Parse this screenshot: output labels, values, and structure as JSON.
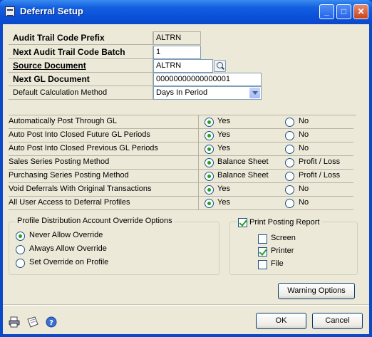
{
  "window": {
    "title": "Deferral Setup",
    "minimize_glyph": "_",
    "maximize_glyph": "□",
    "close_glyph": "✕"
  },
  "header": {
    "audit_prefix_label": "Audit Trail Code Prefix",
    "audit_prefix_value": "ALTRN",
    "next_batch_label": "Next Audit Trail Code Batch",
    "next_batch_value": "1",
    "source_doc_label": "Source Document",
    "source_doc_value": "ALTRN",
    "next_gl_label": "Next GL Document",
    "next_gl_value": "00000000000000001",
    "calc_method_label": "Default Calculation Method",
    "calc_method_value": "Days In Period"
  },
  "options": [
    {
      "label": "Automatically Post Through GL",
      "opt1": "Yes",
      "opt2": "No",
      "selected": 1
    },
    {
      "label": "Auto Post Into Closed Future GL Periods",
      "opt1": "Yes",
      "opt2": "No",
      "selected": 1
    },
    {
      "label": "Auto Post Into Closed Previous GL Periods",
      "opt1": "Yes",
      "opt2": "No",
      "selected": 1
    },
    {
      "label": "Sales Series Posting Method",
      "opt1": "Balance Sheet",
      "opt2": "Profit / Loss",
      "selected": 1
    },
    {
      "label": "Purchasing Series Posting Method",
      "opt1": "Balance Sheet",
      "opt2": "Profit / Loss",
      "selected": 1
    },
    {
      "label": "Void Deferrals With Original Transactions",
      "opt1": "Yes",
      "opt2": "No",
      "selected": 1
    },
    {
      "label": "All User Access to Deferral Profiles",
      "opt1": "Yes",
      "opt2": "No",
      "selected": 1
    }
  ],
  "profile_override": {
    "title": "Profile Distribution Account Override Options",
    "items": [
      "Never Allow Override",
      "Always Allow Override",
      "Set Override on Profile"
    ],
    "selected": 0
  },
  "print_report": {
    "label": "Print Posting Report",
    "checked": true,
    "items": [
      {
        "label": "Screen",
        "checked": false
      },
      {
        "label": "Printer",
        "checked": true
      },
      {
        "label": "File",
        "checked": false
      }
    ]
  },
  "buttons": {
    "warning_options": "Warning Options",
    "ok": "OK",
    "cancel": "Cancel"
  },
  "status_icons": [
    "printer-icon",
    "note-icon",
    "help-icon"
  ],
  "colors": {
    "titlebar": "#0c49c9",
    "client_bg": "#ece9d8",
    "radio_dot": "#21a121"
  }
}
